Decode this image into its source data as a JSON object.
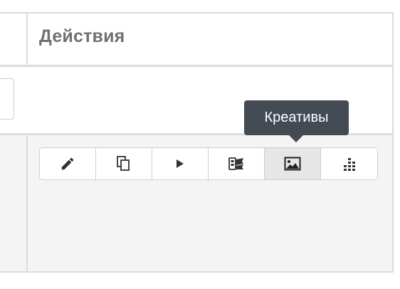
{
  "table": {
    "header": {
      "actions_label": "Действия"
    }
  },
  "toolbar": {
    "buttons": [
      {
        "icon": "pencil-icon",
        "name": "edit"
      },
      {
        "icon": "copy-icon",
        "name": "copy"
      },
      {
        "icon": "play-icon",
        "name": "play"
      },
      {
        "icon": "billing-icon",
        "name": "finance"
      },
      {
        "icon": "image-icon",
        "name": "creatives",
        "active": true
      },
      {
        "icon": "chart-icon",
        "name": "stats"
      }
    ],
    "tooltip": "Креативы"
  },
  "colors": {
    "tooltip_bg": "#434a54",
    "header_text": "#707070",
    "row_alt_bg": "#f4f4f4",
    "active_button_bg": "#e6e6e6"
  }
}
